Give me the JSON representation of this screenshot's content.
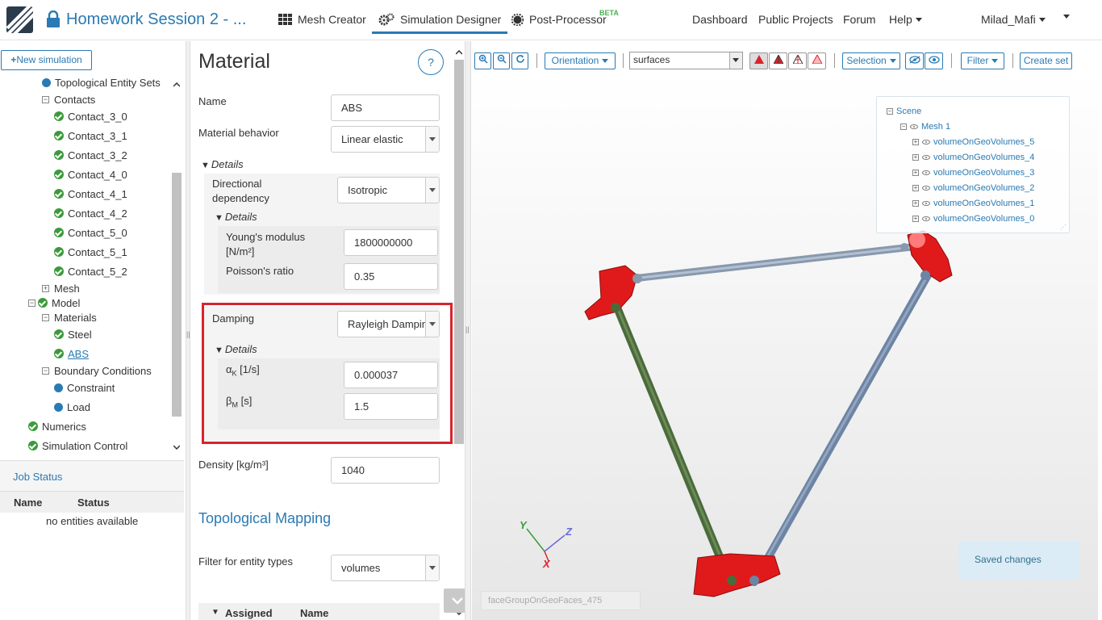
{
  "header": {
    "project_title": "Homework Session 2 - ...",
    "nav": [
      {
        "label": "Mesh Creator"
      },
      {
        "label": "Simulation Designer"
      },
      {
        "label": "Post-Processor",
        "badge": "BETA"
      }
    ],
    "right_nav": [
      {
        "label": "Dashboard"
      },
      {
        "label": "Public Projects"
      },
      {
        "label": "Forum"
      },
      {
        "label": "Help"
      }
    ],
    "user": "Milad_Mafi"
  },
  "sidebar": {
    "new_simulation": "New simulation",
    "tree": [
      {
        "label": "Topological Entity Sets",
        "icon": "dot"
      },
      {
        "label": "Contacts",
        "icon": "toggle-minus"
      },
      {
        "label": "Contact_3_0",
        "icon": "check"
      },
      {
        "label": "Contact_3_1",
        "icon": "check"
      },
      {
        "label": "Contact_3_2",
        "icon": "check"
      },
      {
        "label": "Contact_4_0",
        "icon": "check"
      },
      {
        "label": "Contact_4_1",
        "icon": "check"
      },
      {
        "label": "Contact_4_2",
        "icon": "check"
      },
      {
        "label": "Contact_5_0",
        "icon": "check"
      },
      {
        "label": "Contact_5_1",
        "icon": "check"
      },
      {
        "label": "Contact_5_2",
        "icon": "check"
      },
      {
        "label": "Mesh",
        "icon": "toggle-plus"
      },
      {
        "label": "Model",
        "icon": "check"
      },
      {
        "label": "Materials",
        "icon": "toggle-minus"
      },
      {
        "label": "Steel",
        "icon": "check"
      },
      {
        "label": "ABS",
        "icon": "check"
      },
      {
        "label": "Boundary Conditions",
        "icon": "toggle-minus"
      },
      {
        "label": "Constraint",
        "icon": "dot"
      },
      {
        "label": "Load",
        "icon": "dot"
      },
      {
        "label": "Numerics",
        "icon": "check"
      },
      {
        "label": "Simulation Control",
        "icon": "check"
      }
    ]
  },
  "job_status": {
    "title": "Job Status",
    "col_name": "Name",
    "col_status": "Status",
    "empty": "no entities available"
  },
  "material": {
    "title": "Material",
    "help": "?",
    "name_label": "Name",
    "name_value": "ABS",
    "behavior_label": "Material behavior",
    "behavior_value": "Linear elastic",
    "details": "Details",
    "dir_label": "Directional dependency",
    "dir_value": "Isotropic",
    "youngs_label": "Young's modulus [N/m²]",
    "youngs_value": "1800000000",
    "poisson_label": "Poisson's ratio",
    "poisson_value": "0.35",
    "damping_label": "Damping",
    "damping_value": "Rayleigh Damping",
    "alpha_label": "α",
    "alpha_sub": "K",
    "alpha_unit": " [1/s]",
    "alpha_value": "0.000037",
    "beta_label": "β",
    "beta_sub": "M",
    "beta_unit": " [s]",
    "beta_value": "1.5",
    "density_label": "Density [kg/m³]",
    "density_value": "1040",
    "topo_title": "Topological Mapping",
    "filter_label": "Filter for entity types",
    "filter_value": "volumes",
    "col_assigned": "Assigned",
    "col_name": "Name"
  },
  "viewer": {
    "toolbar": {
      "orientation": "Orientation",
      "render_mode": "surfaces",
      "selection": "Selection",
      "filter": "Filter",
      "create_set": "Create set"
    },
    "scene": {
      "root": "Scene",
      "mesh": "Mesh 1",
      "volumes": [
        "volumeOnGeoVolumes_5",
        "volumeOnGeoVolumes_4",
        "volumeOnGeoVolumes_3",
        "volumeOnGeoVolumes_2",
        "volumeOnGeoVolumes_1",
        "volumeOnGeoVolumes_0"
      ]
    },
    "axes": {
      "x": "X",
      "y": "Y",
      "z": "Z"
    },
    "toast": "Saved changes",
    "hover_label": "faceGroupOnGeoFaces_475",
    "colors": {
      "accent": "#2a7ab3",
      "highlight": "#d9232d",
      "rod_green": "#4a6b3a",
      "rod_blue": "#6d84a3"
    }
  }
}
